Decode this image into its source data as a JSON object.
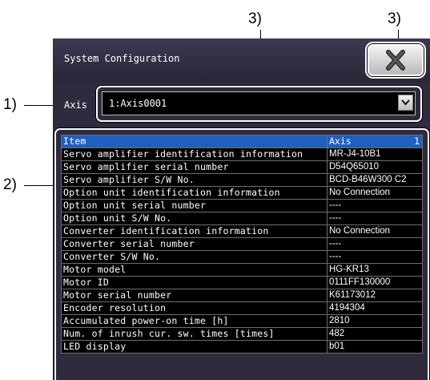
{
  "callouts": {
    "axis_callout": "1)",
    "table_callout": "2)",
    "select_callout": "3)",
    "close_callout": "3)"
  },
  "window": {
    "title": "System Configuration",
    "close_icon": "close-x-icon"
  },
  "axis": {
    "label": "Axis",
    "selected": "1:Axis0001"
  },
  "table": {
    "header": {
      "item": "Item",
      "value": "Axis",
      "axis_number": "1"
    },
    "rows": [
      {
        "item": "Servo amplifier identification information",
        "value": "MR-J4-10B1"
      },
      {
        "item": "Servo amplifier serial number",
        "value": "D54Q65010"
      },
      {
        "item": "Servo amplifier S/W No.",
        "value": "BCD-B46W300 C2"
      },
      {
        "item": "Option unit identification information",
        "value": "No Connection"
      },
      {
        "item": "Option unit serial number",
        "value": "----"
      },
      {
        "item": "Option unit S/W No.",
        "value": "----"
      },
      {
        "item": "Converter identification information",
        "value": "No Connection"
      },
      {
        "item": "Converter serial number",
        "value": "----"
      },
      {
        "item": "Converter S/W No.",
        "value": "----"
      },
      {
        "item": "Motor model",
        "value": "HG-KR13"
      },
      {
        "item": "Motor ID",
        "value": "0111FF130000"
      },
      {
        "item": "Motor serial number",
        "value": "K61173012"
      },
      {
        "item": "Encoder resolution",
        "value": "4194304"
      },
      {
        "item": "Accumulated power-on time [h]",
        "value": "2810"
      },
      {
        "item": "Num. of inrush cur. sw. times [times]",
        "value": "482"
      },
      {
        "item": "LED display",
        "value": "b01"
      }
    ]
  }
}
